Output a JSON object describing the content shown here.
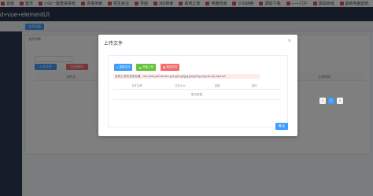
{
  "bookmarks": [
    {
      "label": "百度"
    },
    {
      "label": "首页"
    },
    {
      "label": "小白一键重装系统"
    },
    {
      "label": "百度搜索"
    },
    {
      "label": "招生就业"
    },
    {
      "label": "导航"
    },
    {
      "label": "360搜索"
    },
    {
      "label": "系统之家"
    },
    {
      "label": "电脑管家"
    },
    {
      "label": "小鸟转换"
    },
    {
      "label": "源码下载"
    },
    {
      "label": "——门户"
    },
    {
      "label": "源码商城"
    },
    {
      "label": "最新电脑壁纸"
    }
  ],
  "app": {
    "title": "d+vue+elementUI"
  },
  "tabs": {
    "active_label": "文件列表"
  },
  "page": {
    "breadcrumb": "文件列表",
    "upload_label": "上传文件",
    "batch_delete_label": "批量删除",
    "columns": [
      "文件名",
      "上传时间"
    ]
  },
  "pagination": {
    "pages": [
      "1",
      "2",
      "3"
    ],
    "active": "2"
  },
  "dialog": {
    "title": "上传文件",
    "close_glyph": "×",
    "buttons": {
      "select": "选择文件",
      "start": "开始上传",
      "clear": "清空文件"
    },
    "tip": "支持上传的文件后缀：doc,docx,pdf,xls,xlsx,ppt,pptx,gif,jpg,jpeg,bmp,png,rar,zip,mp4,avi",
    "columns": [
      "文件名称",
      "文件大小",
      "进度",
      "操作"
    ],
    "empty_text": "暂无数据",
    "confirm": "确 定"
  },
  "colors": {
    "primary": "#409eff",
    "success": "#67c23a",
    "danger": "#f56c6c",
    "header": "#26324a"
  }
}
